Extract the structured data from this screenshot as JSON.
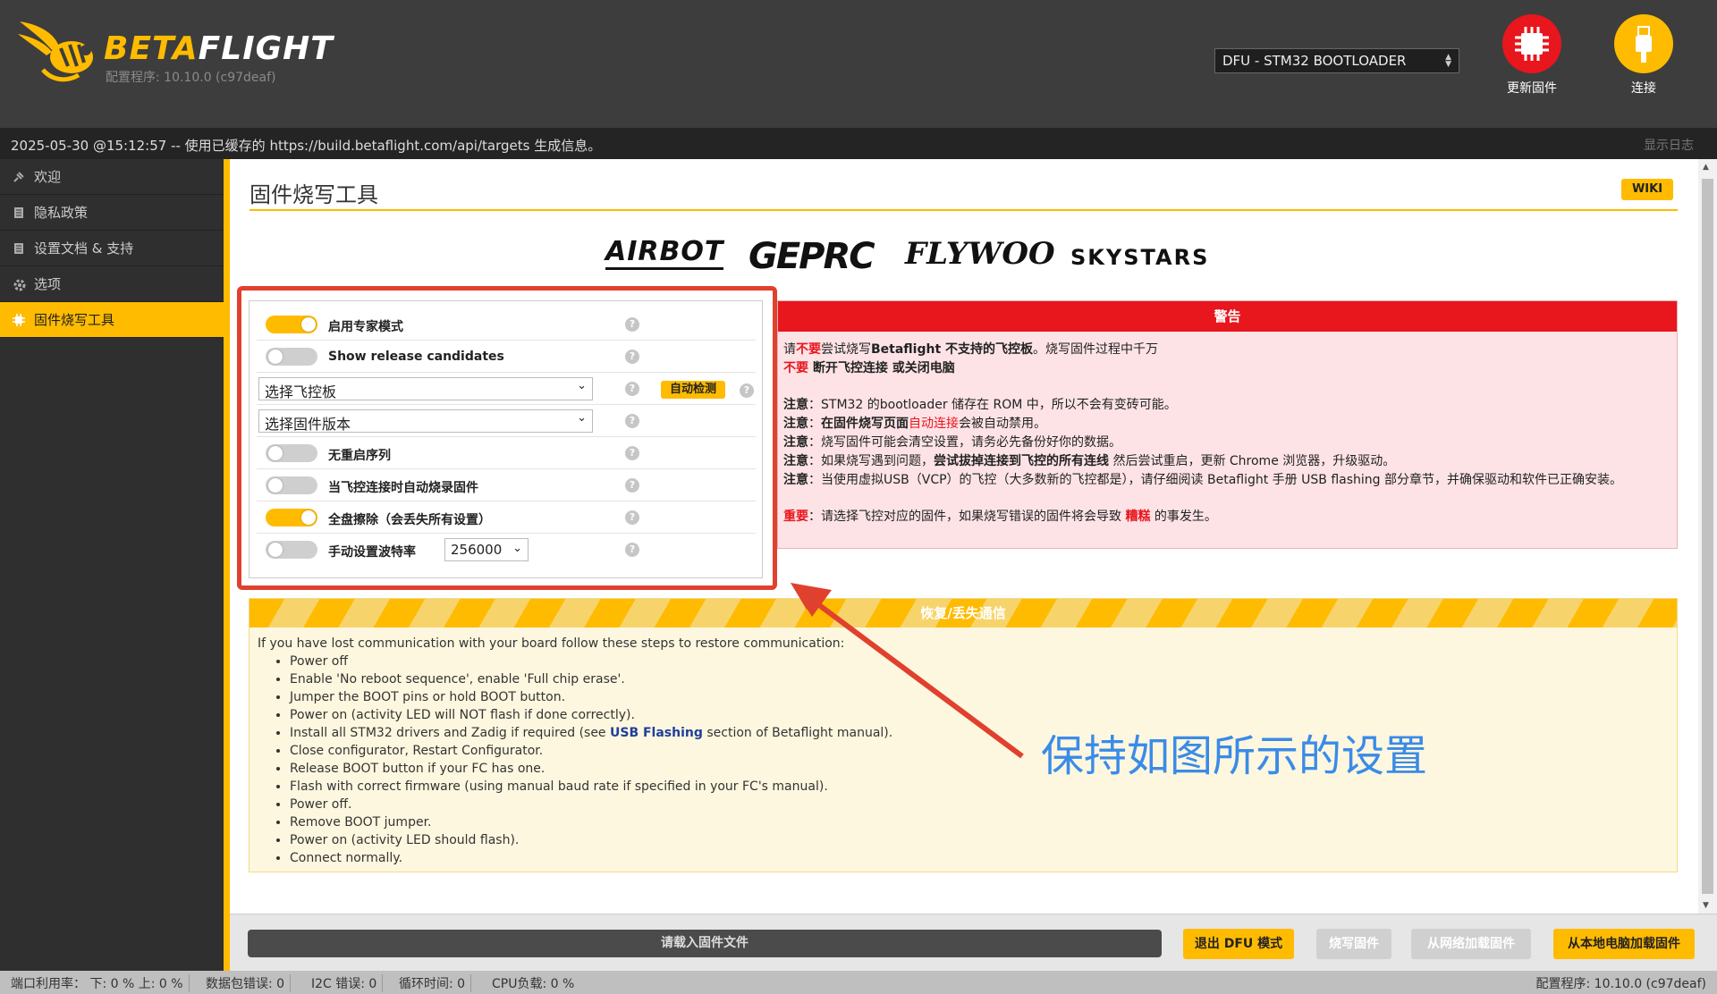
{
  "header": {
    "brand_beta": "BETA",
    "brand_flight": "FLIGHT",
    "version_label": "配置程序: 10.10.0 (c97deaf)",
    "port_selected": "DFU - STM32 BOOTLOADER",
    "update_firmware_label": "更新固件",
    "connect_label": "连接",
    "colors": {
      "accent": "#ffbb00",
      "danger": "#e8161d"
    }
  },
  "logbar": {
    "message": "2025-05-30 @15:12:57 -- 使用已缓存的 https://build.betaflight.com/api/targets 生成信息。",
    "show_log": "显示日志"
  },
  "sidebar": {
    "items": [
      {
        "label": "欢迎",
        "icon": "plug-icon"
      },
      {
        "label": "隐私政策",
        "icon": "document-icon"
      },
      {
        "label": "设置文档 & 支持",
        "icon": "document-icon"
      },
      {
        "label": "选项",
        "icon": "gear-icon"
      },
      {
        "label": "固件烧写工具",
        "icon": "chip-icon",
        "active": true
      }
    ]
  },
  "main": {
    "title": "固件烧写工具",
    "wiki": "WIKI",
    "sponsors": [
      "AIRBOT",
      "GEPRC",
      "FLYWOO",
      "SKYSTARS"
    ],
    "options": {
      "expert_mode": "启用专家模式",
      "release_candidates": "Show release candidates",
      "board_select": "选择飞控板",
      "auto_detect": "自动检测",
      "firmware_select": "选择固件版本",
      "no_reboot": "无重启序列",
      "flash_on_connect": "当飞控连接时自动烧录固件",
      "full_erase": "全盘擦除（会丢失所有设置）",
      "manual_baud": "手动设置波特率",
      "baud_value": "256000",
      "help": "?"
    },
    "warning": {
      "title": "警告",
      "l1a": "请",
      "l1b": "不要",
      "l1c": "尝试烧写",
      "l1d": "Betaflight 不支持的飞控板",
      "l1e": "。烧写固件过程中千万",
      "l2a": "不要",
      "l2b": " 断开飞控连接 或关闭电脑",
      "note": "注意",
      "n1": "：STM32 的bootloader 储存在 ROM 中，所以不会有变砖可能。",
      "n2a": "：",
      "n2b": "在固件烧写页面",
      "n2c": "自动连接",
      "n2d": "会被自动禁用。",
      "n3": "：烧写固件可能会清空设置，请务必先备份好你的数据。",
      "n4a": "：如果烧写遇到问题，",
      "n4b": "尝试拔掉连接到飞控的所有连线",
      "n4c": " 然后尝试重启，更新 Chrome 浏览器，升级驱动。",
      "n5": "：当使用虚拟USB（VCP）的飞控（大多数新的飞控都是），请仔细阅读 Betaflight 手册 USB flashing 部分章节，并确保驱动和软件已正确安装。",
      "imp": "重要",
      "imp_a": "：请选择飞控对应的固件，如果烧写错误的固件将会导致 ",
      "imp_b": "糟糕",
      "imp_c": " 的事发生。"
    },
    "recovery": {
      "title": "恢复/丢失通信",
      "intro": "If you have lost communication with your board follow these steps to restore communication:",
      "steps": [
        "Power off",
        "Enable 'No reboot sequence', enable 'Full chip erase'.",
        "Jumper the BOOT pins or hold BOOT button.",
        "Power on (activity LED will NOT flash if done correctly).",
        "Close configurator, Restart Configurator.",
        "Release BOOT button if your FC has one.",
        "Flash with correct firmware (using manual baud rate if specified in your FC's manual).",
        "Power off.",
        "Remove BOOT jumper.",
        "Power on (activity LED should flash).",
        "Connect normally."
      ],
      "usb_a": "Install all STM32 drivers and Zadig if required (see ",
      "usb_link": "USB Flashing",
      "usb_b": " section of Betaflight manual)."
    },
    "annotation": "保持如图所示的设置"
  },
  "bottom": {
    "load_firmware": "请载入固件文件",
    "exit_dfu": "退出 DFU 模式",
    "flash": "烧写固件",
    "load_online": "从网络加载固件",
    "load_local": "从本地电脑加载固件"
  },
  "status": {
    "port_util": "端口利用率：  下: 0 %  上: 0 %",
    "packet_err": "数据包错误: 0",
    "i2c_err": "I2C 错误: 0",
    "cycle": "循环时间: 0",
    "cpu": "CPU负载: 0 %",
    "version": "配置程序: 10.10.0 (c97deaf)"
  }
}
